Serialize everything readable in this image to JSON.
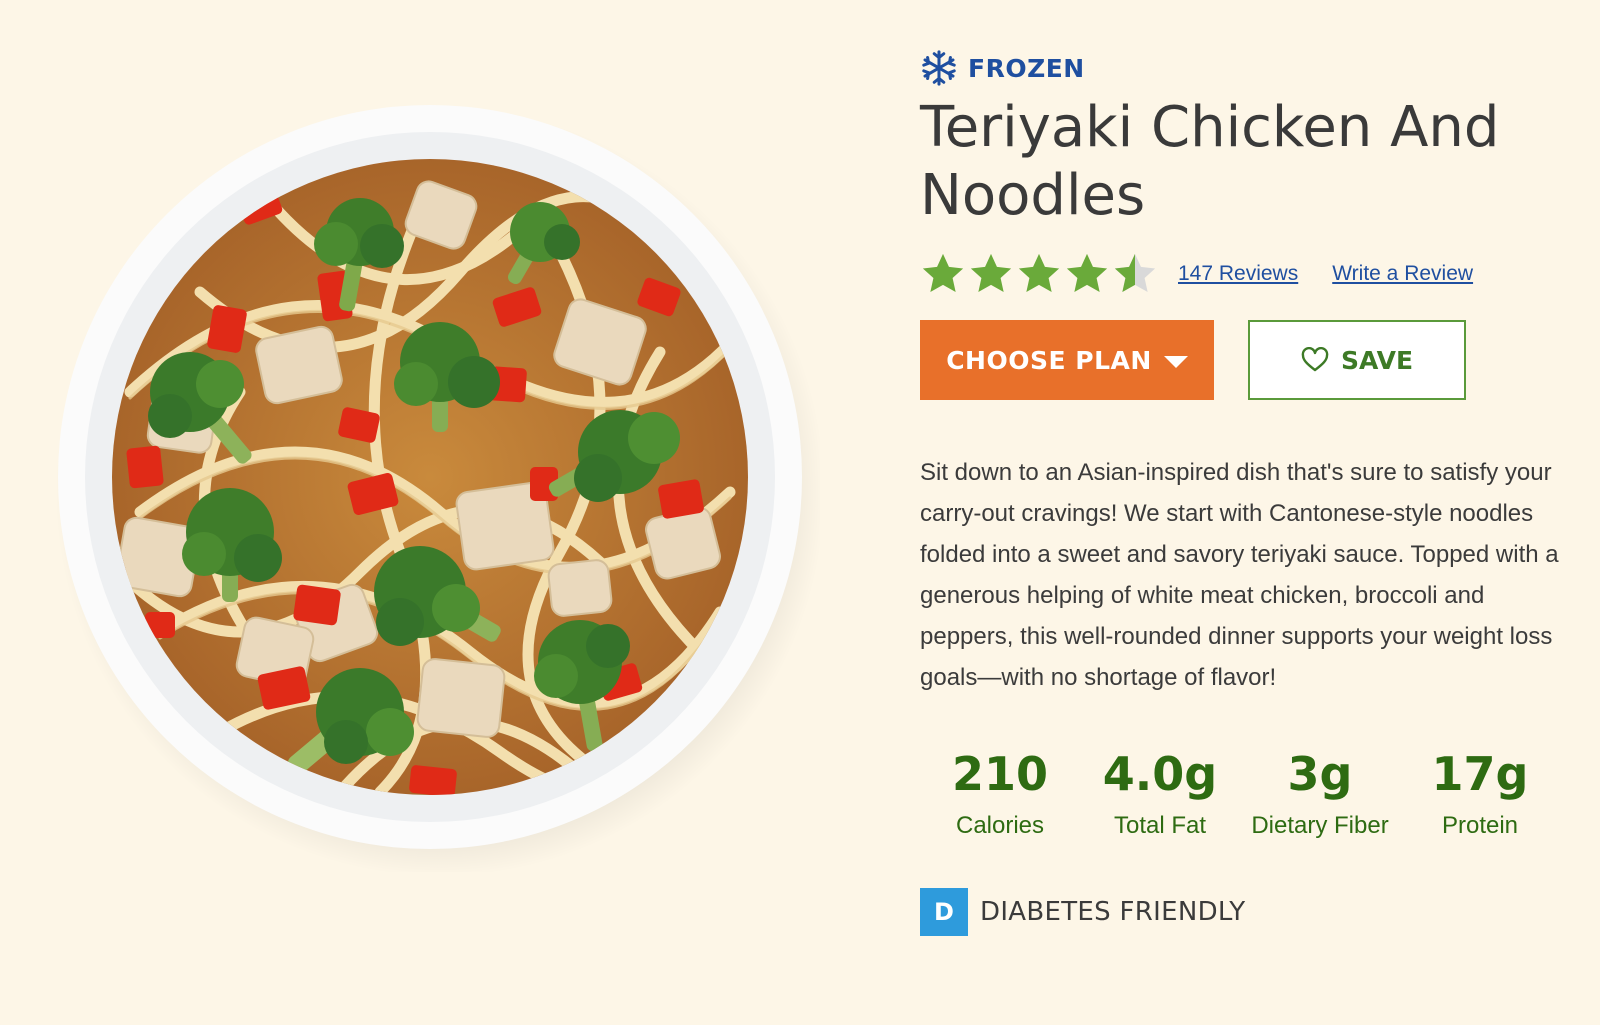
{
  "product": {
    "category_label": "FROZEN",
    "category_icon": "snowflake-icon",
    "title": "Teriyaki Chicken And Noodles",
    "image_icon": "teriyaki-chicken-noodles-bowl"
  },
  "rating": {
    "value": 4.5,
    "max": 5,
    "star_color": "#6aaa3a",
    "empty_star_color": "#d9d9d9",
    "reviews_link": "147 Reviews",
    "write_review_link": "Write a Review"
  },
  "actions": {
    "choose_plan_label": "CHOOSE PLAN",
    "save_label": "SAVE",
    "choose_plan_color": "#e8702a",
    "save_border_color": "#5a9a3a"
  },
  "description": "Sit down to an Asian-inspired dish that's sure to satisfy your carry-out cravings! We start with Cantonese-style noodles folded into a sweet and savory teriyaki sauce. Topped with a generous helping of white meat chicken, broccoli and peppers, this well-rounded dinner supports your weight loss goals—with no shortage of flavor!",
  "nutrition": [
    {
      "value": "210",
      "label": "Calories"
    },
    {
      "value": "4.0g",
      "label": "Total Fat"
    },
    {
      "value": "3g",
      "label": "Dietary Fiber"
    },
    {
      "value": "17g",
      "label": "Protein"
    }
  ],
  "badge": {
    "letter": "D",
    "label": "DIABETES FRIENDLY",
    "color": "#2e9bdc"
  },
  "colors": {
    "background": "#fdf6e7",
    "brand_blue": "#1f4fa0",
    "nutrition_green": "#2e6b12"
  }
}
